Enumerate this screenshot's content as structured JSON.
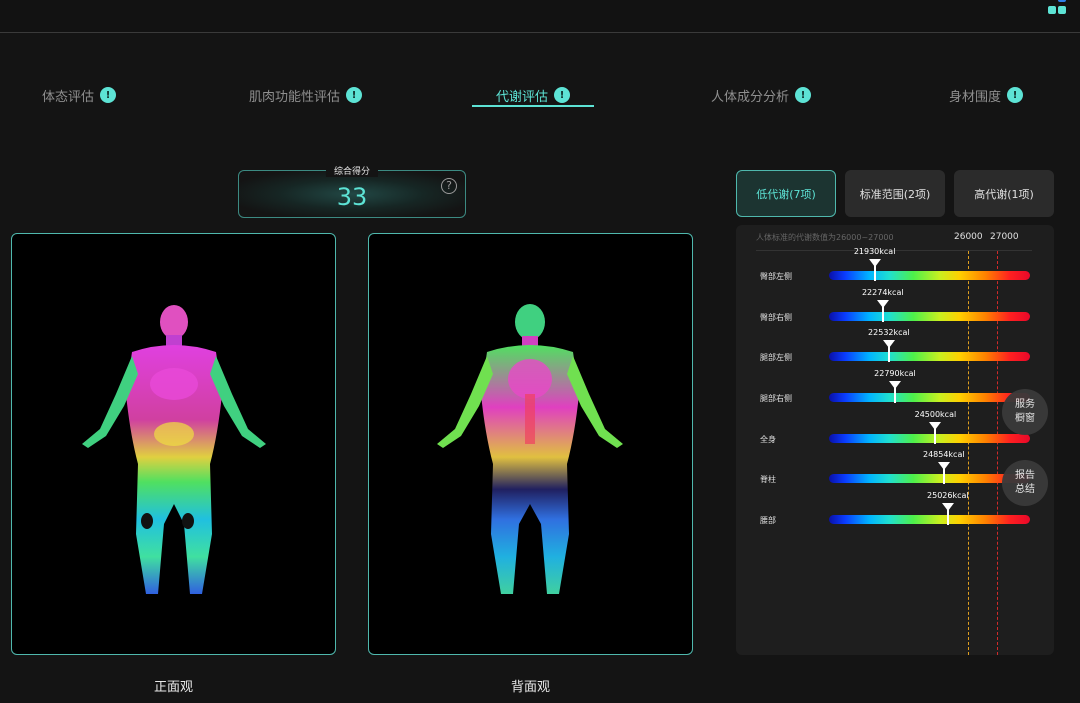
{
  "tabs": [
    {
      "label": "体态评估",
      "badge": "!"
    },
    {
      "label": "肌肉功能性评估",
      "badge": "!"
    },
    {
      "label": "代谢评估",
      "badge": "!",
      "active": true
    },
    {
      "label": "人体成分分析",
      "badge": "!"
    },
    {
      "label": "身材围度",
      "badge": "!"
    }
  ],
  "score": {
    "label": "综合得分",
    "value": "33",
    "help_icon": "question-circle-icon"
  },
  "views": {
    "front": "正面观",
    "back": "背面观"
  },
  "filters": {
    "low": "低代谢(7项)",
    "standard": "标准范围(2项)",
    "high": "高代谢(1项)"
  },
  "metabolism": {
    "standard_note": "人体标准的代谢数值为26000~27000",
    "threshold_low": "26000",
    "threshold_high": "27000",
    "scale_min": 20000,
    "scale_max": 28500,
    "rows": [
      {
        "name": "臀部左侧",
        "value": 21930,
        "value_label": "21930kcal"
      },
      {
        "name": "臀部右侧",
        "value": 22274,
        "value_label": "22274kcal"
      },
      {
        "name": "腿部左侧",
        "value": 22532,
        "value_label": "22532kcal"
      },
      {
        "name": "腿部右侧",
        "value": 22790,
        "value_label": "22790kcal"
      },
      {
        "name": "全身",
        "value": 24500,
        "value_label": "24500kcal"
      },
      {
        "name": "脊柱",
        "value": 24854,
        "value_label": "24854kcal"
      },
      {
        "name": "腰部",
        "value": 25026,
        "value_label": "25026kcal"
      }
    ]
  },
  "floating": {
    "service": [
      "服务",
      "橱窗"
    ],
    "report": [
      "报告",
      "总结"
    ]
  },
  "colors": {
    "accent": "#5de3d5",
    "threshold_low": "#e0a020",
    "threshold_high": "#d02a2a"
  }
}
